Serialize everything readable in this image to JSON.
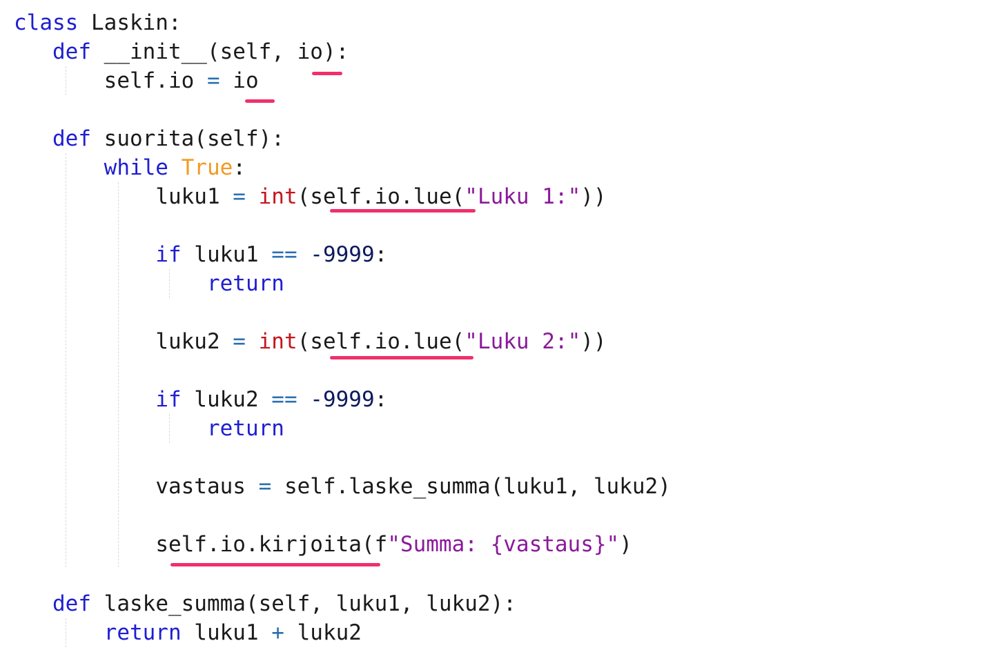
{
  "code": {
    "line1": {
      "kw": "class",
      "rest": " Laskin:"
    },
    "line2": {
      "indent": "   ",
      "kw": "def",
      "rest": " __init__(self, io):"
    },
    "line3": {
      "indent": "       ",
      "a": "self.io ",
      "op": "=",
      "b": " io"
    },
    "line5": {
      "indent": "   ",
      "kw": "def",
      "rest": " suorita(self):"
    },
    "line6": {
      "indent": "       ",
      "kw": "while",
      "sp": " ",
      "kw2": "True",
      "rest": ":"
    },
    "line7": {
      "indent": "           ",
      "a": "luku1 ",
      "op": "=",
      "sp": " ",
      "bi": "int",
      "b": "(self.io.lue(",
      "str": "\"Luku 1:\"",
      "c": "))"
    },
    "line9": {
      "indent": "           ",
      "kw": "if",
      "a": " luku1 ",
      "op": "==",
      "sp": " ",
      "num": "-9999",
      "rest": ":"
    },
    "line10": {
      "indent": "               ",
      "kw": "return"
    },
    "line12": {
      "indent": "           ",
      "a": "luku2 ",
      "op": "=",
      "sp": " ",
      "bi": "int",
      "b": "(self.io.lue(",
      "str": "\"Luku 2:\"",
      "c": "))"
    },
    "line14": {
      "indent": "           ",
      "kw": "if",
      "a": " luku2 ",
      "op": "==",
      "sp": " ",
      "num": "-9999",
      "rest": ":"
    },
    "line15": {
      "indent": "               ",
      "kw": "return"
    },
    "line17": {
      "indent": "           ",
      "a": "vastaus ",
      "op": "=",
      "b": " self.laske_summa(luku1, luku2)"
    },
    "line19": {
      "indent": "           ",
      "a": "self.io.kirjoita(f",
      "str": "\"Summa: {vastaus}\"",
      "c": ")"
    },
    "line21": {
      "indent": "   ",
      "kw": "def",
      "rest": " laske_summa(self, luku1, luku2):"
    },
    "line22": {
      "indent": "       ",
      "kw": "return",
      "a": " luku1 ",
      "op": "+",
      "b": " luku2"
    }
  },
  "colors": {
    "keyword": "#1e1ed2",
    "constant": "#f29a22",
    "builtin": "#c4161c",
    "string": "#8a1a9a",
    "number": "#0b1a5e",
    "operator": "#2a6fb0",
    "underline": "#f0306a"
  }
}
